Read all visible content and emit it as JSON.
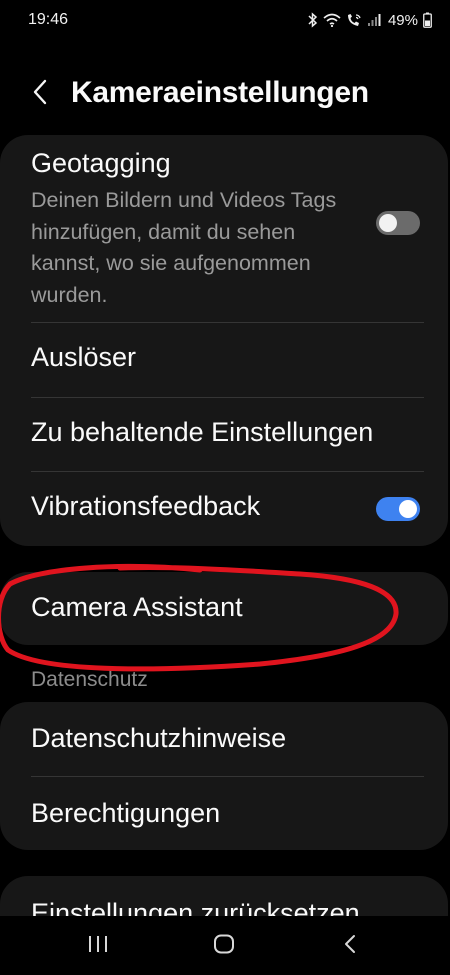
{
  "status_bar": {
    "time": "19:46",
    "battery": "49%",
    "icons": [
      "bluetooth-icon",
      "wifi-icon",
      "wifi-call-icon",
      "signal-icon",
      "battery-icon"
    ]
  },
  "header": {
    "title": "Kameraeinstellungen",
    "back_icon": "chevron-left-icon"
  },
  "settings_card": {
    "geotagging": {
      "title": "Geotagging",
      "description": "Deinen Bildern und Videos Tags hinzufügen, damit du sehen kannst, wo sie aufgenommen wurden.",
      "enabled": false
    },
    "shutter": {
      "title": "Auslöser"
    },
    "settings_to_keep": {
      "title": "Zu behaltende Einstellungen"
    },
    "vibration_feedback": {
      "title": "Vibrationsfeedback",
      "enabled": true
    }
  },
  "camera_assistant_card": {
    "title": "Camera Assistant"
  },
  "privacy_section": {
    "label": "Datenschutz",
    "items": [
      {
        "title": "Datenschutzhinweise"
      },
      {
        "title": "Berechtigungen"
      }
    ]
  },
  "reset_card": {
    "title": "Einstellungen zurücksetzen"
  },
  "nav_bar": {
    "icons": [
      "recent-apps-icon",
      "home-icon",
      "back-icon"
    ]
  },
  "colors": {
    "background": "#000000",
    "card": "#171717",
    "text": "#fafafa",
    "secondary_text": "#9a9a9a",
    "toggle_on": "#3e82f0",
    "toggle_off": "#6b6b6b",
    "annotation": "#e0141e"
  }
}
